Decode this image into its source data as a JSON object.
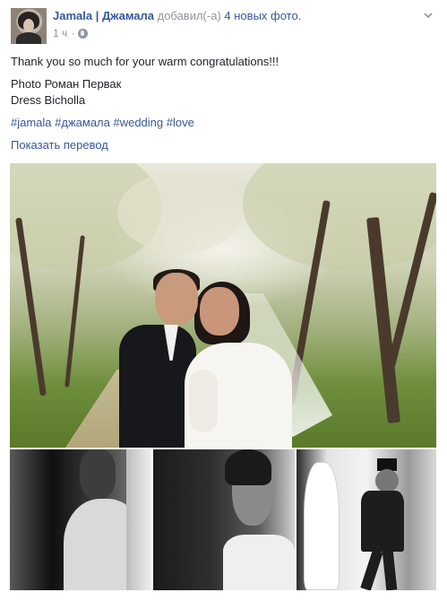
{
  "post": {
    "author": "Jamala | Джамала",
    "action": "добавил(-а)",
    "photos_link": "4 новых фото.",
    "time": "1 ч",
    "separator": "·"
  },
  "content": {
    "line1": "Thank you so much for your warm congratulations!!!",
    "line2": "Photo Роман Первак",
    "line3": "Dress Bicholla",
    "hashtags": "#jamala #джамала #wedding #love",
    "translate_link": "Показать перевод"
  },
  "icons": {
    "privacy": "globe-icon",
    "menu": "chevron-down-icon"
  },
  "colors": {
    "link": "#365899",
    "meta": "#90949c",
    "text": "#1d2129"
  }
}
